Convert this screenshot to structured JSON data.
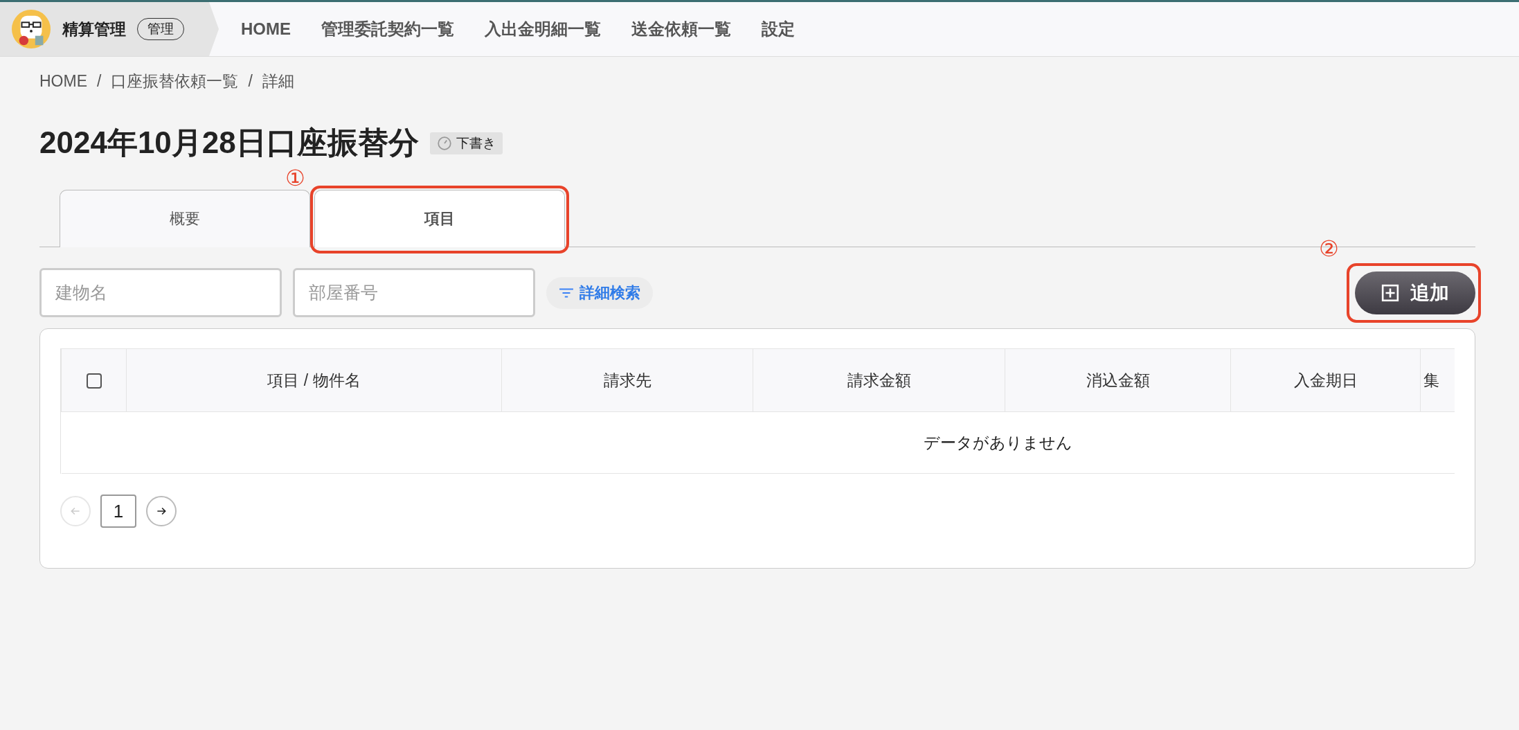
{
  "header": {
    "app_name": "精算管理",
    "role_badge": "管理",
    "nav": [
      {
        "label": "HOME"
      },
      {
        "label": "管理委託契約一覧"
      },
      {
        "label": "入出金明細一覧"
      },
      {
        "label": "送金依頼一覧"
      },
      {
        "label": "設定"
      }
    ]
  },
  "breadcrumb": [
    "HOME",
    "口座振替依頼一覧",
    "詳細"
  ],
  "breadcrumb_separator": "/",
  "title": "2024年10月28日口座振替分",
  "status_badge": "下書き",
  "tabs": [
    {
      "label": "概要",
      "selected": false
    },
    {
      "label": "項目",
      "selected": true,
      "annotation": "①"
    }
  ],
  "filters": {
    "building": {
      "placeholder": "建物名"
    },
    "room": {
      "placeholder": "部屋番号"
    },
    "advanced_search": "詳細検索"
  },
  "add_button": {
    "label": "追加",
    "annotation": "②"
  },
  "table": {
    "select_all_checked": false,
    "columns": [
      "項目 / 物件名",
      "請求先",
      "請求金額",
      "消込金額",
      "入金期日",
      "集"
    ],
    "empty_message": "データがありません"
  },
  "pagination": {
    "prev_disabled": true,
    "pages": [
      {
        "label": "1",
        "selected": true
      }
    ],
    "next_disabled": false
  }
}
